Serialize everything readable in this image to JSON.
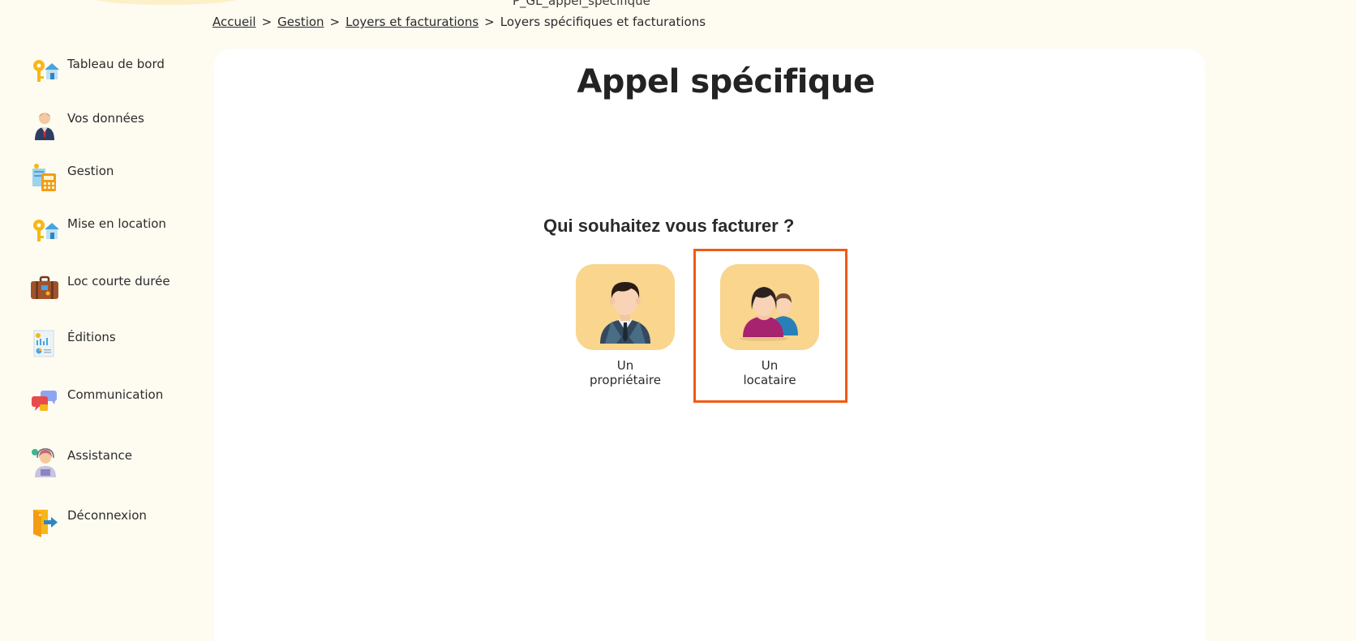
{
  "page_code": "P_GL_appel_specifique",
  "breadcrumb": {
    "items": [
      "Accueil",
      "Gestion",
      "Loyers et facturations"
    ],
    "current": "Loyers spécifiques et facturations",
    "separator": ">"
  },
  "sidebar": {
    "items": [
      {
        "label": "Tableau de bord",
        "icon": "keys-house-icon"
      },
      {
        "label": "Vos données",
        "icon": "businessman-icon"
      },
      {
        "label": "Gestion",
        "icon": "calculator-icon"
      },
      {
        "label": "Mise en location",
        "icon": "keys-house-icon"
      },
      {
        "label": "Loc courte durée",
        "icon": "suitcase-icon"
      },
      {
        "label": "Éditions",
        "icon": "report-icon"
      },
      {
        "label": "Communication",
        "icon": "chat-bubbles-icon"
      },
      {
        "label": "Assistance",
        "icon": "support-agent-icon"
      },
      {
        "label": "Déconnexion",
        "icon": "logout-door-icon"
      }
    ]
  },
  "main": {
    "title": "Appel spécifique",
    "question": "Qui souhaitez vous facturer ?",
    "choices": [
      {
        "label": "Un\npropriétaire",
        "icon": "owner-avatar-icon"
      },
      {
        "label": "Un\nlocataire",
        "icon": "tenant-avatar-icon"
      }
    ]
  },
  "colors": {
    "background": "#fefbf1",
    "card": "#ffffff",
    "tile": "#f9d58e",
    "highlight": "#f05a14"
  }
}
